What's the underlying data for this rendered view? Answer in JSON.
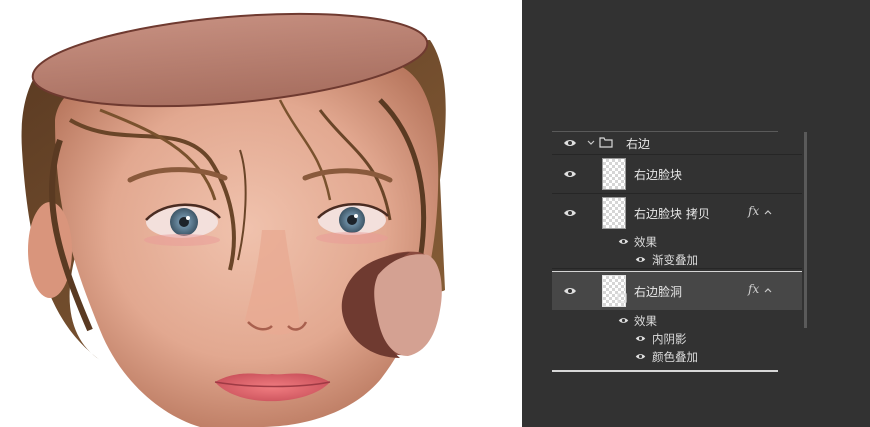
{
  "layers_panel": {
    "group": {
      "name": "右边",
      "expanded": true,
      "icon": "folder-icon"
    },
    "layers": [
      {
        "name": "右边脸块",
        "visible": true,
        "has_fx": false
      },
      {
        "name": "右边脸块 拷贝",
        "visible": true,
        "has_fx": true,
        "fx_label": "fx",
        "effects_label": "效果",
        "effects": [
          "渐变叠加"
        ]
      },
      {
        "name": "右边脸洞",
        "visible": true,
        "has_fx": true,
        "fx_label": "fx",
        "selected": true,
        "effects_label": "效果",
        "effects": [
          "内阴影",
          "颜色叠加"
        ]
      }
    ]
  },
  "colors": {
    "panel_bg": "#323232",
    "selected_row_bg": "#474747",
    "skin_cut": "#b47c6e",
    "skin_cut_dark": "#6f3a30"
  }
}
